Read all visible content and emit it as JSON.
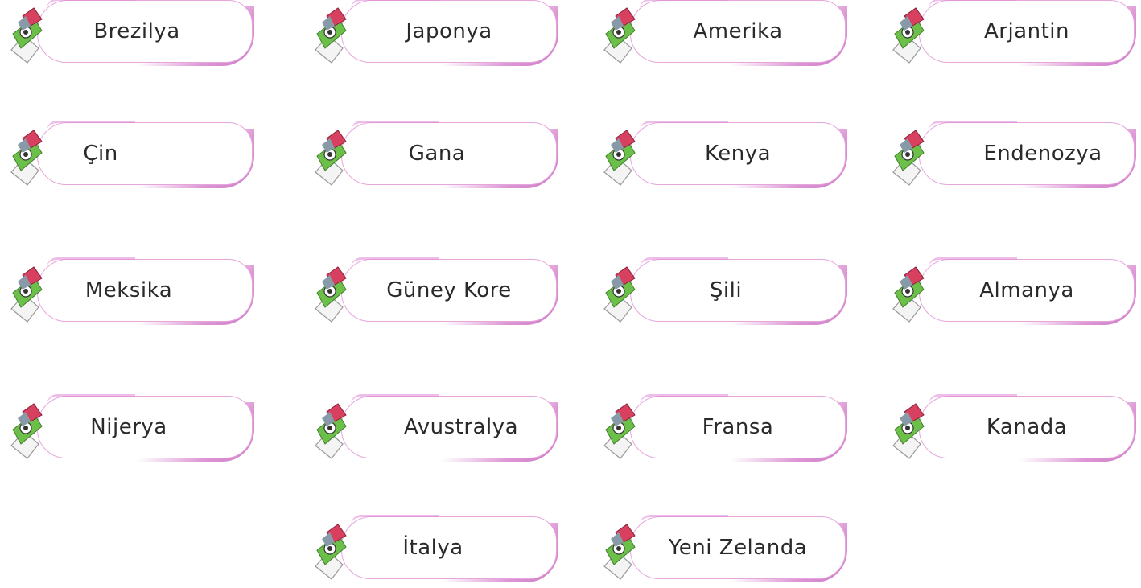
{
  "cards": [
    {
      "label": "Brezilya"
    },
    {
      "label": "Japonya"
    },
    {
      "label": "Amerika"
    },
    {
      "label": "Arjantin"
    },
    {
      "label": "Çin"
    },
    {
      "label": "Gana"
    },
    {
      "label": "Kenya"
    },
    {
      "label": "Endenozya"
    },
    {
      "label": "Meksika"
    },
    {
      "label": "Güney Kore"
    },
    {
      "label": "Şili"
    },
    {
      "label": "Almanya"
    },
    {
      "label": "Nijerya"
    },
    {
      "label": "Avustralya"
    },
    {
      "label": "Fransa"
    },
    {
      "label": "Kanada"
    },
    {
      "label": "İtalya"
    },
    {
      "label": "Yeni Zelanda"
    }
  ],
  "icons": {
    "mascot": "pencil-mascot-icon"
  },
  "colors": {
    "border": "#e6a6dc",
    "shadow": "#c86cc0",
    "text": "#2a2a2a",
    "mascot_body": "#6cc04a",
    "mascot_cap": "#d84060"
  }
}
